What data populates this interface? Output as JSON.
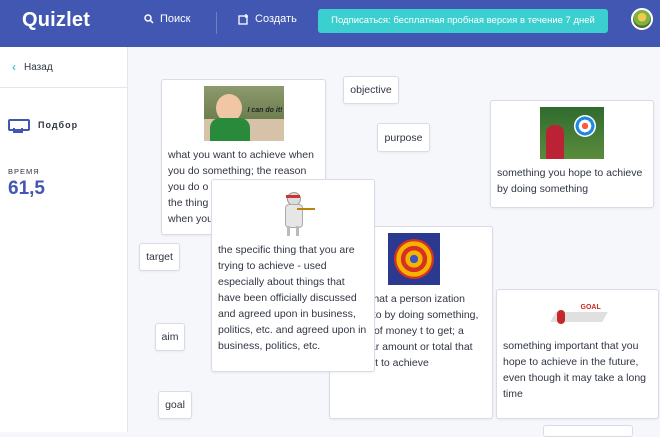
{
  "header": {
    "logo": "Quizlet",
    "search_label": "Поиск",
    "create_label": "Создать",
    "subscribe_label": "Подписаться: бесплатная пробная версия в течение 7 дней"
  },
  "sidebar": {
    "back_label": "Назад",
    "mode_label": "Подбор",
    "time_label": "ВРЕМЯ",
    "time_value": "61,5"
  },
  "cards": {
    "objective": "objective",
    "purpose": "purpose",
    "target": "target",
    "aim": "aim",
    "goal": "goal",
    "def_want": "what you want to achieve when you do something; the reason you do o",
    "def_want_line3": "the thing",
    "def_want_line4": "when you",
    "def_hope": "something you hope to achieve by doing something",
    "def_specific": "the specific thing that you are trying to achieve - used especially about things that have been officially discussed and agreed upon in business, politics, etc. and agreed upon in business, politics, etc.",
    "def_result": "t result that a person ization intends to by doing something, amount of money t to get; a particular amount or total that you want to achieve",
    "def_important": "something important that you hope to achieve in the future, even though it may take a long time",
    "img_kid_text": "I can do it!",
    "img_goal_text": "GOAL"
  },
  "colors": {
    "brand": "#4257b2",
    "accent": "#3ccfcf"
  }
}
